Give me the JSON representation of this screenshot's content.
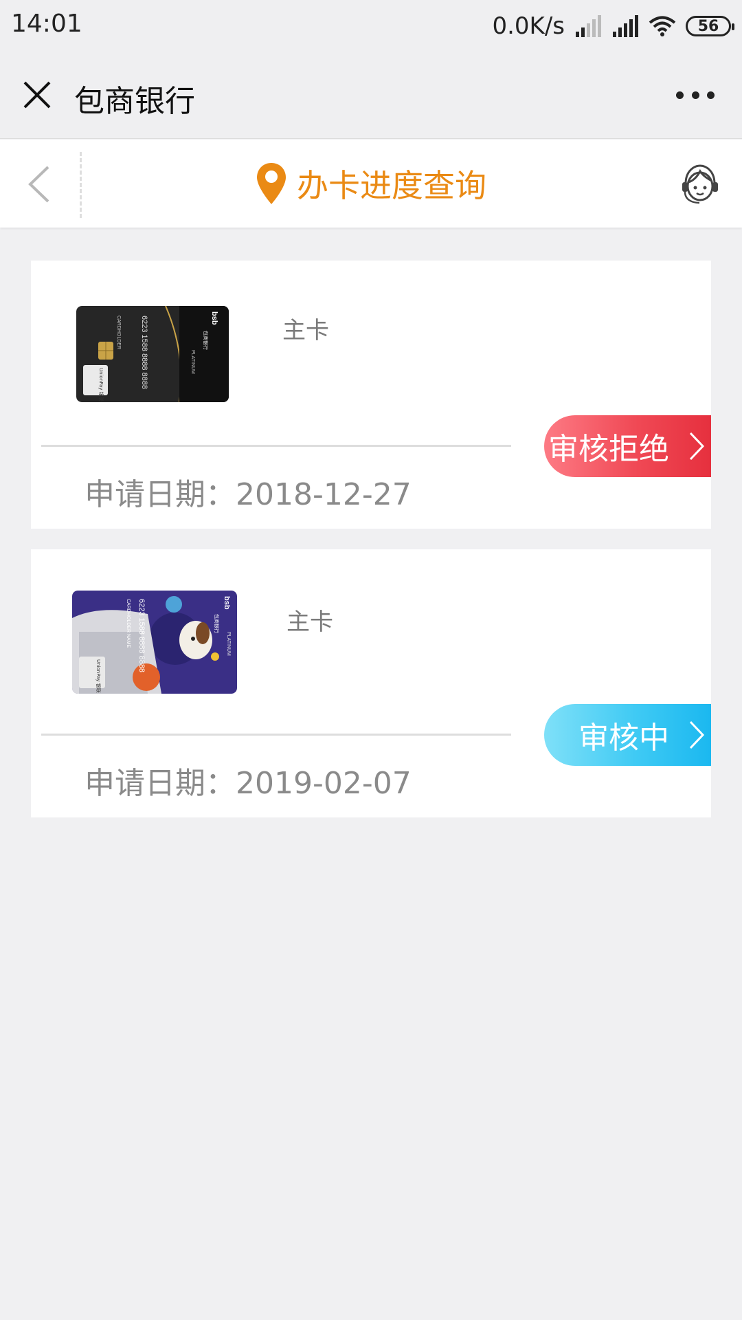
{
  "status_bar": {
    "time": "14:01",
    "network_speed": "0.0K/s",
    "battery": "56",
    "icons": [
      "signal-icon",
      "signal-icon",
      "wifi-icon",
      "battery-icon"
    ]
  },
  "app_bar": {
    "title": "包商银行",
    "icons": [
      "close-icon",
      "more-icon"
    ]
  },
  "page_nav": {
    "title": "办卡进度查询",
    "accent_color": "#ea8a14",
    "icons": [
      "back-icon",
      "location-pin-icon",
      "customer-service-icon"
    ]
  },
  "applications": [
    {
      "card_type": "主卡",
      "apply_date": "申请日期：2018-12-27",
      "status": "审核拒绝",
      "status_color": "#e6303e",
      "card_image": {
        "bank_logo": "bsb",
        "bank_name": "包商银行",
        "card_number": "6223 1588 8888 8888",
        "holder": "CARDHOLDER",
        "tier": "PLATINUM",
        "network": "UnionPay 银联"
      }
    },
    {
      "card_type": "主卡",
      "apply_date": "申请日期：2019-02-07",
      "status": "审核中",
      "status_color": "#1bb8f0",
      "card_image": {
        "bank_logo": "bsb",
        "bank_name": "包商银行",
        "card_number": "6223 1588 8888 8888",
        "holder": "CARDHOLDER NAME",
        "tier": "PLATINUM",
        "network": "UnionPay 银联"
      }
    }
  ]
}
